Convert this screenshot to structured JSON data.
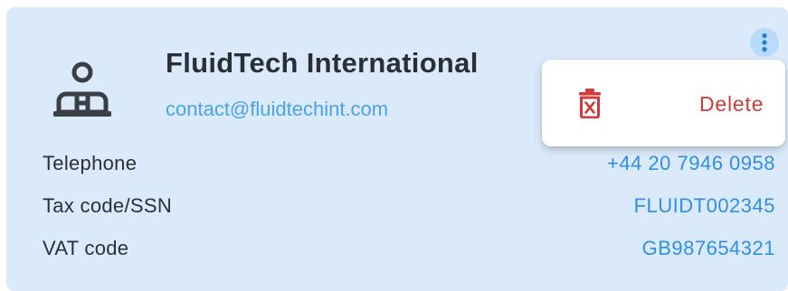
{
  "contact": {
    "name": "FluidTech International",
    "email": "contact@fluidtechint.com"
  },
  "details": [
    {
      "label": "Telephone",
      "value": "+44 20 7946 0958"
    },
    {
      "label": "Tax code/SSN",
      "value": "FLUIDT002345"
    },
    {
      "label": "VAT code",
      "value": "GB987654321"
    }
  ],
  "menu": {
    "delete_label": "Delete"
  },
  "icons": {
    "avatar": "person-desk-icon",
    "more": "more-vertical-icon",
    "delete": "trash-icon"
  },
  "colors": {
    "card_background": "#dbeafb",
    "link": "#2f8ee5",
    "danger": "#d03a3a"
  }
}
